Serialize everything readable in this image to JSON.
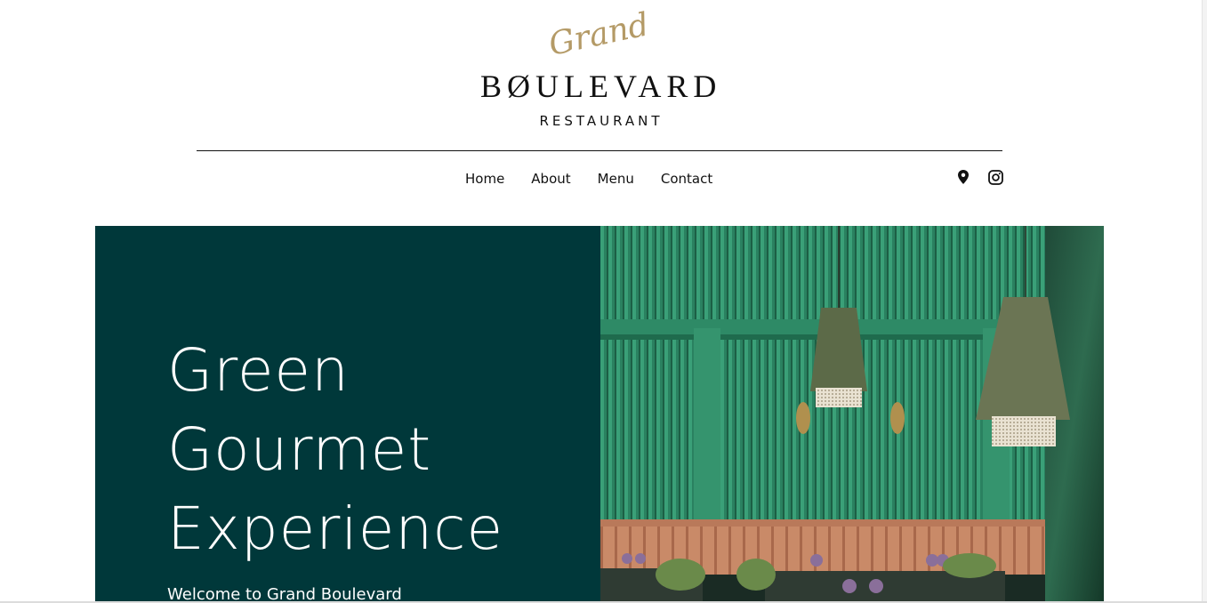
{
  "logo": {
    "script": "Grand",
    "main": "BØULEVARD",
    "sub": "RESTAURANT"
  },
  "nav": {
    "items": [
      "Home",
      "About",
      "Menu",
      "Contact"
    ]
  },
  "social": {
    "icons": [
      "location-pin-icon",
      "instagram-icon"
    ]
  },
  "hero": {
    "title_lines": [
      "Green",
      "Gourmet",
      "Experience"
    ],
    "subtitle": "Welcome to Grand Boulevard",
    "colors": {
      "panel": "#00383a",
      "wall": "#2f8c63",
      "banquette": "#c98a68"
    }
  }
}
